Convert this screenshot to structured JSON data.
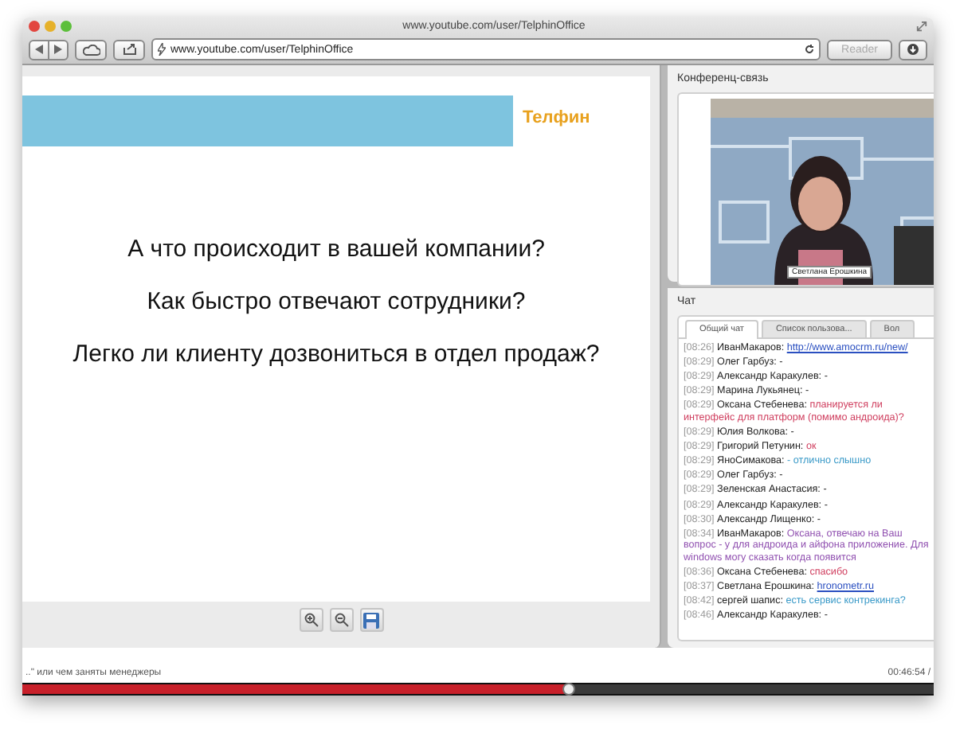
{
  "window": {
    "title": "www.youtube.com/user/TelphinOffice"
  },
  "toolbar": {
    "address": "www.youtube.com/user/TelphinOffice",
    "reader": {
      "label": "Reader",
      "disabled": true
    }
  },
  "slide": {
    "logo": "Телфин",
    "lines": [
      "А что происходит в вашей компании?",
      "Как быстро отвечают сотрудники?",
      "Легко ли клиенту дозвониться в отдел продаж?"
    ]
  },
  "conference": {
    "title": "Конференц-связь",
    "video": {
      "kind": "picture",
      "caption": "Светлана Ерошкина"
    }
  },
  "chat": {
    "title": "Чат",
    "tabs": [
      {
        "label": "Общий чат",
        "selected": true
      },
      {
        "label": "Список пользова...",
        "selected": false
      },
      {
        "label": "Вол",
        "selected": false
      }
    ],
    "messages": [
      {
        "time": "[08:26]",
        "name": "ИванМакаров:",
        "text": "http://www.amocrm.ru/new/",
        "kind": "link"
      },
      {
        "time": "[08:29]",
        "name": "Олег Гарбуз:",
        "text": "-",
        "kind": "plain"
      },
      {
        "time": "[08:29]",
        "name": "Александр Каракулев:",
        "text": "-",
        "kind": "plain"
      },
      {
        "time": "[08:29]",
        "name": "Марина Лукьянец:",
        "text": "-",
        "kind": "plain"
      },
      {
        "time": "[08:29]",
        "name": "Оксана Стебенева:",
        "text": "планируется ли интерфейс для платформ (помимо андроида)?",
        "kind": "colored",
        "color": "#d04060"
      },
      {
        "time": "[08:29]",
        "name": "Юлия Волкова:",
        "text": "-",
        "kind": "plain"
      },
      {
        "time": "[08:29]",
        "name": "Григорий Петунин:",
        "text": "ок",
        "kind": "colored",
        "color": "#d04060"
      },
      {
        "time": "[08:29]",
        "name": "ЯноСимакова:",
        "text": "- отлично слышно",
        "kind": "colored",
        "color": "#3a9ac8"
      },
      {
        "time": "[08:29]",
        "name": "Олег Гарбуз:",
        "text": "-",
        "kind": "plain"
      },
      {
        "time": "[08:29]",
        "name": "Зеленская Анастасия:",
        "text": "-",
        "kind": "plain"
      },
      {
        "time": "[08:29]",
        "name": "Александр Каракулев:",
        "text": "-",
        "kind": "plain"
      },
      {
        "time": "[08:30]",
        "name": "Александр Лищенко:",
        "text": "-",
        "kind": "plain"
      },
      {
        "time": "[08:34]",
        "name": "ИванМакаров:",
        "text": "Оксана, отвечаю на Ваш вопрос - у для андроида и айфона приложение. Для windows могу сказать когда появится",
        "kind": "colored",
        "color": "#9050b0"
      },
      {
        "time": "[08:36]",
        "name": "Оксана Стебенева:",
        "text": "спасибо",
        "kind": "colored",
        "color": "#d04060"
      },
      {
        "time": "[08:37]",
        "name": "Светлана Ерошкина:",
        "text": "hronometr.ru",
        "kind": "link"
      },
      {
        "time": "[08:42]",
        "name": "сергей шапис:",
        "text": "есть сервис контрекинга?",
        "kind": "colored",
        "color": "#3a9ac8"
      },
      {
        "time": "[08:46]",
        "name": "Александр Каракулев:",
        "text": "-",
        "kind": "plain"
      }
    ]
  },
  "player": {
    "caption": "..\" или чем заняты менеджеры",
    "time": "00:46:54 /",
    "level": 0.6
  }
}
